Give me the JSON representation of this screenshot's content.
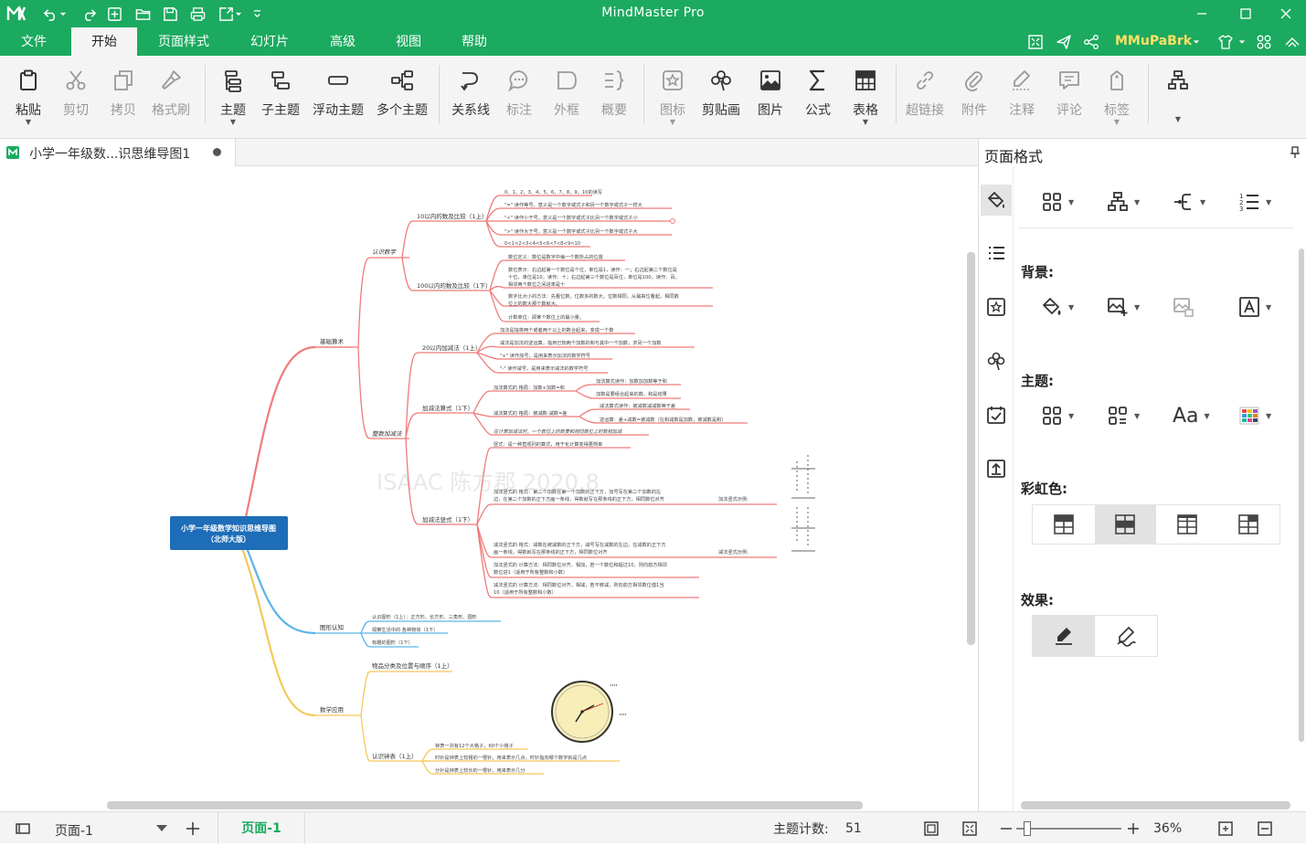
{
  "app": {
    "title": "MindMaster Pro",
    "user": "MMuPaBrk",
    "accent": "#1baa5f"
  },
  "menu": [
    "文件",
    "开始",
    "页面样式",
    "幻灯片",
    "高级",
    "视图",
    "帮助"
  ],
  "ribbon": {
    "paste": "粘贴",
    "cut": "剪切",
    "copy": "拷贝",
    "format_painter": "格式刷",
    "topic": "主题",
    "subtopic": "子主题",
    "floating": "浮动主题",
    "multi": "多个主题",
    "relation": "关系线",
    "callout": "标注",
    "boundary": "外框",
    "summary": "概要",
    "icon": "图标",
    "clipart": "剪贴画",
    "picture": "图片",
    "formula": "公式",
    "table": "表格",
    "hyperlink": "超链接",
    "attachment": "附件",
    "note": "注释",
    "comment": "评论",
    "tag": "标签"
  },
  "doc_tab": "小学一年级数...识思维导图1",
  "panel": {
    "title": "页面格式",
    "background": "背景:",
    "theme": "主题:",
    "rainbow": "彩虹色:",
    "effect": "效果:",
    "font_sample": "Aa"
  },
  "status": {
    "page_select": "页面-1",
    "page_tab": "页面-1",
    "topic_count_label": "主题计数:",
    "topic_count": "51",
    "zoom": "36%"
  },
  "mindmap": {
    "watermark": "ISAAC 陈方郡 2020.8",
    "root": [
      "小学一年级数学知识思维导图",
      "（北师大版）"
    ],
    "branches": {
      "basic": "基础算术",
      "know": "认识数字",
      "within10": "10以内的数及比较（1上）",
      "within100": "100以内的数及比较（1下）",
      "integer_ops": "整数加减法",
      "add20": "20以内加减法（1上）",
      "addsub": "加减法算式（1下）",
      "vertical": "加减法竖式（1下）",
      "shape": "图形认知",
      "math_app": "数学应用",
      "classify": "物品分类及位置与顺序（1上）",
      "clock": "认识钟表（1上）"
    },
    "leaves": {
      "n1": "0、1、2、3、4、5、6、7、8、9、10的读写",
      "n2": "\"=\" 读作等号，意义是一个数字或式子和另一个数字或式子一样大",
      "n3": "\"<\" 读作小于号，意义是一个数字或式子比另一个数字或式子小",
      "n4": "\">\" 读作大于号，意义是一个数字或式子比另一个数字或式子大",
      "n5": "0<1<2<3<4<5<6<7<8<9<10",
      "h1": "数位定义：数位是数字中每一个数所占的位置",
      "h2a": "数位表示：右边起第一个数位是个位，单位是1，读作：一；右边起第二个数位是",
      "h2b": "十位，单位是10，读作：十；右边起第三个数位是百位，单位是100，读作：百。",
      "h2c": "相邻两个数位之间进率是十",
      "h3a": "数字比大小的方法：先看位数，位数多的数大，位数相同，从最高位看起，相同数",
      "h3b": "位上的数大那个数就大。",
      "h4": "计数单位：即某个数位上的最小量。",
      "a1": "加法是指将两个或者两个以上的数合起来，变成一个数",
      "a2": "减法是加法的逆运算，指用已知两个加数的和与其中一个加数，求另一个加数",
      "a3": "\"+\" 读作加号，是用来表示加法的数学符号",
      "a4": "\"-\" 读作减号，是用来表示减法的数学符号",
      "b1": "加法算式的 格局：加数+加数=和",
      "b1a": "加法算式读作：加数加加数等于和",
      "b1b": "加数是要组合起来的数，和是结果",
      "b2": "减法算式的 格局：被减数-减数=差",
      "b2a": "减法算式读作：被减数减减数等于差",
      "b2b": "逆运算：差+减数=被减数（在和减数是加数，被减数是和）",
      "b3": "在计算加减法时，一个数位上的数要和相同数位上的数相加减",
      "c1": "竖式：是一种直观列的算式，用于化计算变得更简单",
      "c2a": "加法竖式的 格式：第二个加数在第一个加数的正下方，加号写在第二个加数的左",
      "c2b": "边，在第二个加数的正下方画一条线，得数就写在那条线的正下方，相同数位对齐",
      "c2c": "加法竖式示例:",
      "c3a": "减法竖式的 格式：减数在被减数的正下方，减号写在减数的左边，在减数的正下方",
      "c3b": "画一条线，得数就写在那条线的正下方，相同数位对齐",
      "c3c": "减法竖式示例:",
      "c4a": "加法竖式的 计算方法：相同数位对齐，相加，若一个数位和超过10，则向前方相邻",
      "c4b": "数位进1（适用于所有整数和小数）",
      "c5a": "减法竖式的 计算方法：相同数位对齐，相减，若不够减，则向前方相邻数位借1当",
      "c5b": "10（适用于所有整数和小数）",
      "s1": "认识图形（1上）：正方形、长方形、三角形、圆形",
      "s2": "观察生活中的 各种物体（1下）",
      "s3": "有趣的图形（1下）",
      "k1": "钟表一共有12个大格子，60个小格子",
      "k2": "时针是钟表上较粗的一根针，用来表示几点，时针指向哪个数字就是几点",
      "k3": "分针是钟表上较长的一根针，用来表示几分"
    }
  }
}
